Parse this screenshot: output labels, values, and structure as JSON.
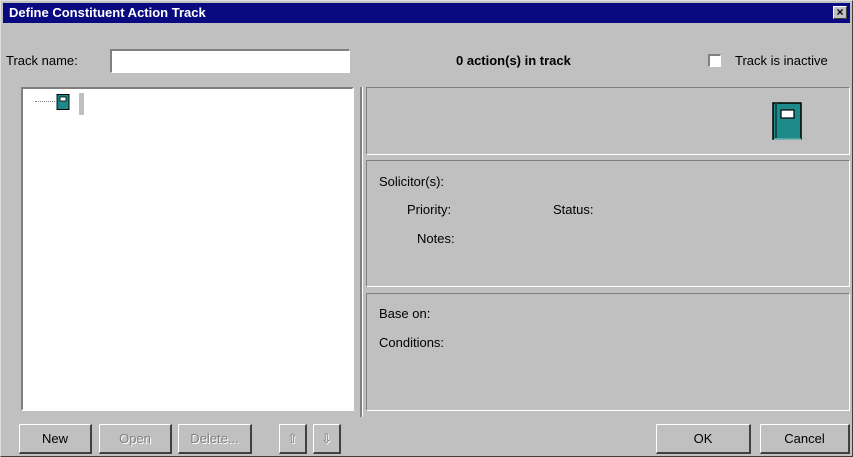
{
  "window": {
    "title": "Define Constituent Action Track",
    "close_glyph": "×"
  },
  "header": {
    "track_name_label": "Track name:",
    "track_name_value": "",
    "action_count": "0 action(s) in track",
    "inactive_label": "Track is inactive",
    "inactive_checked": false
  },
  "detail": {
    "solicitors_label": "Solicitor(s):",
    "priority_label": "Priority:",
    "status_label": "Status:",
    "notes_label": "Notes:",
    "base_on_label": "Base on:",
    "conditions_label": "Conditions:"
  },
  "buttons": {
    "new": "New",
    "open": "Open",
    "delete": "Delete...",
    "move_up": "⇧",
    "move_down": "⇩",
    "ok": "OK",
    "cancel": "Cancel"
  },
  "icons": {
    "tree_root": "notebook-icon",
    "large": "notebook-icon",
    "notebook_color": "#1f8a8a"
  }
}
